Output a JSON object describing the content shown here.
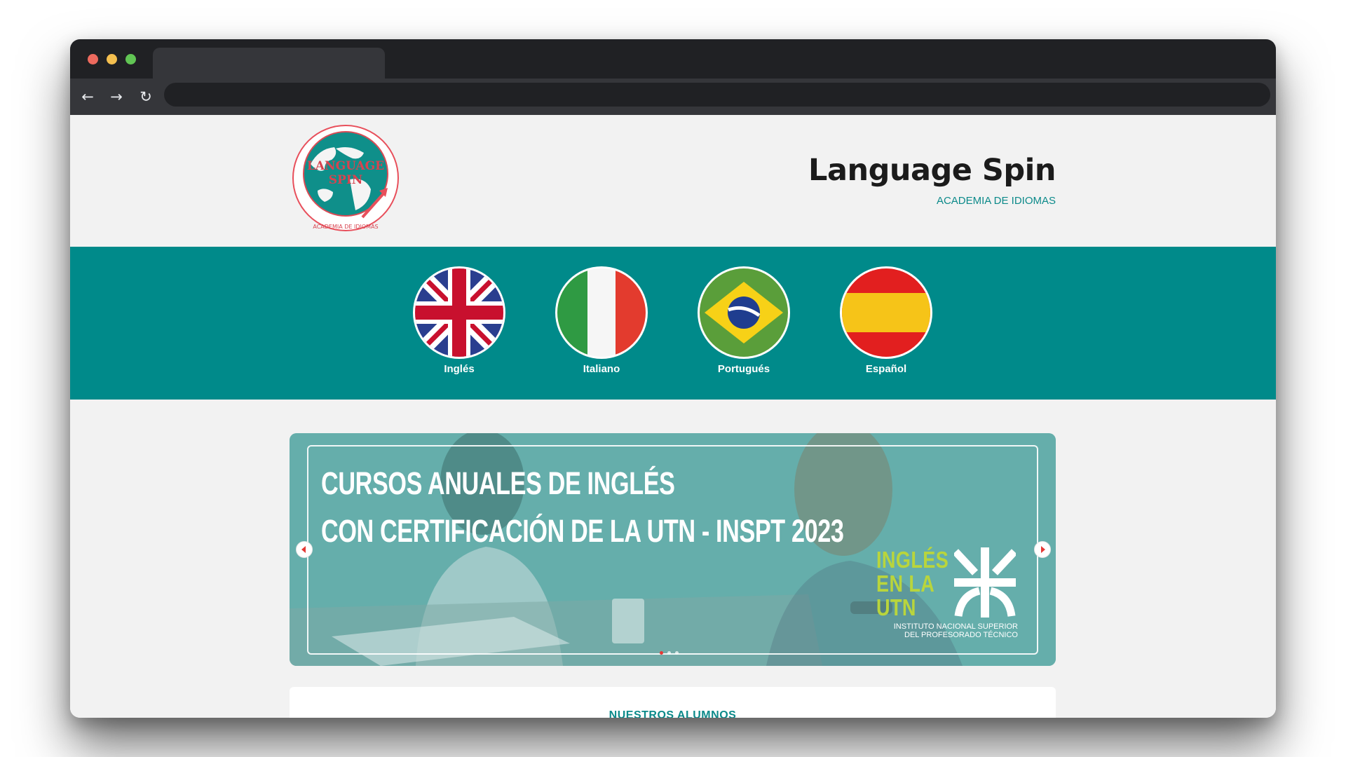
{
  "browser": {
    "tab_title": "",
    "url": ""
  },
  "site": {
    "logo_text_line1": "LANGUAGE",
    "logo_text_line2": "SPIN",
    "logo_ring_text": "ACADEMIA DE IDIOMAS",
    "title": "Language Spin",
    "subtitle": "ACADEMIA DE IDIOMAS"
  },
  "languages": [
    {
      "label": "Inglés",
      "flag": "uk-flag-icon"
    },
    {
      "label": "Italiano",
      "flag": "italy-flag-icon"
    },
    {
      "label": "Portugués",
      "flag": "brazil-flag-icon"
    },
    {
      "label": "Español",
      "flag": "spain-flag-icon"
    }
  ],
  "banner": {
    "line1": "CURSOS ANUALES DE INGLÉS",
    "line2": "CON CERTIFICACIÓN DE LA UTN - INSPT 2023",
    "badge_line1": "INGLÉS",
    "badge_line2": "EN LA",
    "badge_line3": "UTN",
    "institute_line1": "INSTITUTO NACIONAL SUPERIOR",
    "institute_line2": "DEL PROFESORADO TÉCNICO",
    "active_slide": 1,
    "slide_count": 3
  },
  "students": {
    "title": "NUESTROS ALUMNOS"
  },
  "colors": {
    "teal": "#008a8a",
    "accent_red": "#e53935",
    "utn_green": "#b9d53c"
  }
}
